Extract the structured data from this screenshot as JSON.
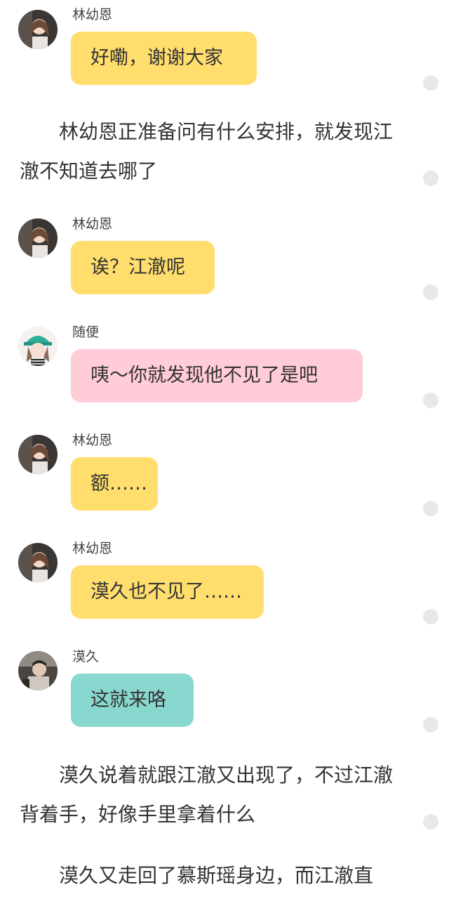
{
  "colors": {
    "yellow_bubble": "#FFDE6E",
    "pink_bubble": "#FFCCD8",
    "teal_bubble": "#88D8CF",
    "dot": "#e8e8e8"
  },
  "messages": [
    {
      "speaker": "林幼恩",
      "text": "好嘞，谢谢大家",
      "avatar": "avatar-linyouen"
    },
    {
      "speaker": "林幼恩",
      "text": "诶？江澈呢",
      "avatar": "avatar-linyouen"
    },
    {
      "speaker": "随便",
      "text": "咦～你就发现他不见了是吧",
      "avatar": "avatar-suibian"
    },
    {
      "speaker": "林幼恩",
      "text": "额……",
      "avatar": "avatar-linyouen"
    },
    {
      "speaker": "林幼恩",
      "text": "漠久也不见了……",
      "avatar": "avatar-linyouen"
    },
    {
      "speaker": "漠久",
      "text": "这就来咯",
      "avatar": "avatar-mojiu"
    }
  ],
  "narration": [
    "林幼恩正准备问有什么安排，就发现江澈不知道去哪了",
    "漠久说着就跟江澈又出现了，不过江澈背着手，好像手里拿着什么",
    "漠久又走回了慕斯瑶身边，而江澈直"
  ]
}
